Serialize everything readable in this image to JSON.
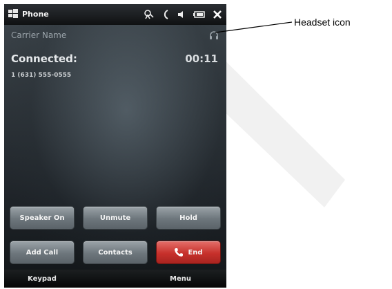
{
  "titlebar": {
    "app_title": "Phone"
  },
  "call": {
    "carrier": "Carrier Name",
    "status": "Connected:",
    "timer": "00:11",
    "number": "1 (631) 555-0555"
  },
  "buttons": {
    "speaker": "Speaker On",
    "unmute": "Unmute",
    "hold": "Hold",
    "add_call": "Add Call",
    "contacts": "Contacts",
    "end": "End"
  },
  "softkeys": {
    "left": "Keypad",
    "right": "Menu"
  },
  "callout": {
    "label": "Headset icon"
  },
  "colors": {
    "end_button": "#c7302b",
    "screen_bg": "#2a3136",
    "button_gray": "#6d767c"
  },
  "icons": [
    "windows-logo-icon",
    "signal-icon",
    "phone-signal-icon",
    "volume-icon",
    "battery-icon",
    "close-icon",
    "headset-icon",
    "phone-icon"
  ]
}
